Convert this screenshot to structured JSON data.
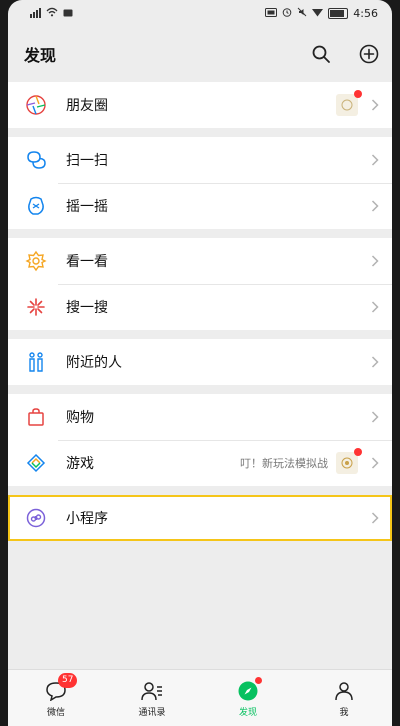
{
  "statusbar": {
    "time": "4:56"
  },
  "header": {
    "title": "发现"
  },
  "groups": [
    {
      "items": [
        {
          "label": "朋友圈",
          "icon": "moments-icon"
        }
      ]
    },
    {
      "items": [
        {
          "label": "扫一扫",
          "icon": "scan-icon"
        },
        {
          "label": "摇一摇",
          "icon": "shake-icon"
        }
      ]
    },
    {
      "items": [
        {
          "label": "看一看",
          "icon": "top-stories-icon"
        },
        {
          "label": "搜一搜",
          "icon": "search-icon"
        }
      ]
    },
    {
      "items": [
        {
          "label": "附近的人",
          "icon": "people-nearby-icon"
        }
      ]
    },
    {
      "items": [
        {
          "label": "购物",
          "icon": "shopping-bag-icon"
        },
        {
          "label": "游戏",
          "icon": "games-icon",
          "extra": "叮！新玩法模拟战"
        }
      ]
    },
    {
      "items": [
        {
          "label": "小程序",
          "icon": "mini-program-icon"
        }
      ]
    }
  ],
  "tabs": [
    {
      "label": "微信",
      "badge": "57"
    },
    {
      "label": "通讯录"
    },
    {
      "label": "发现"
    },
    {
      "label": "我"
    }
  ],
  "colors": {
    "accent": "#07c160",
    "highlight": "#f5c518",
    "badge": "#ff3333"
  }
}
